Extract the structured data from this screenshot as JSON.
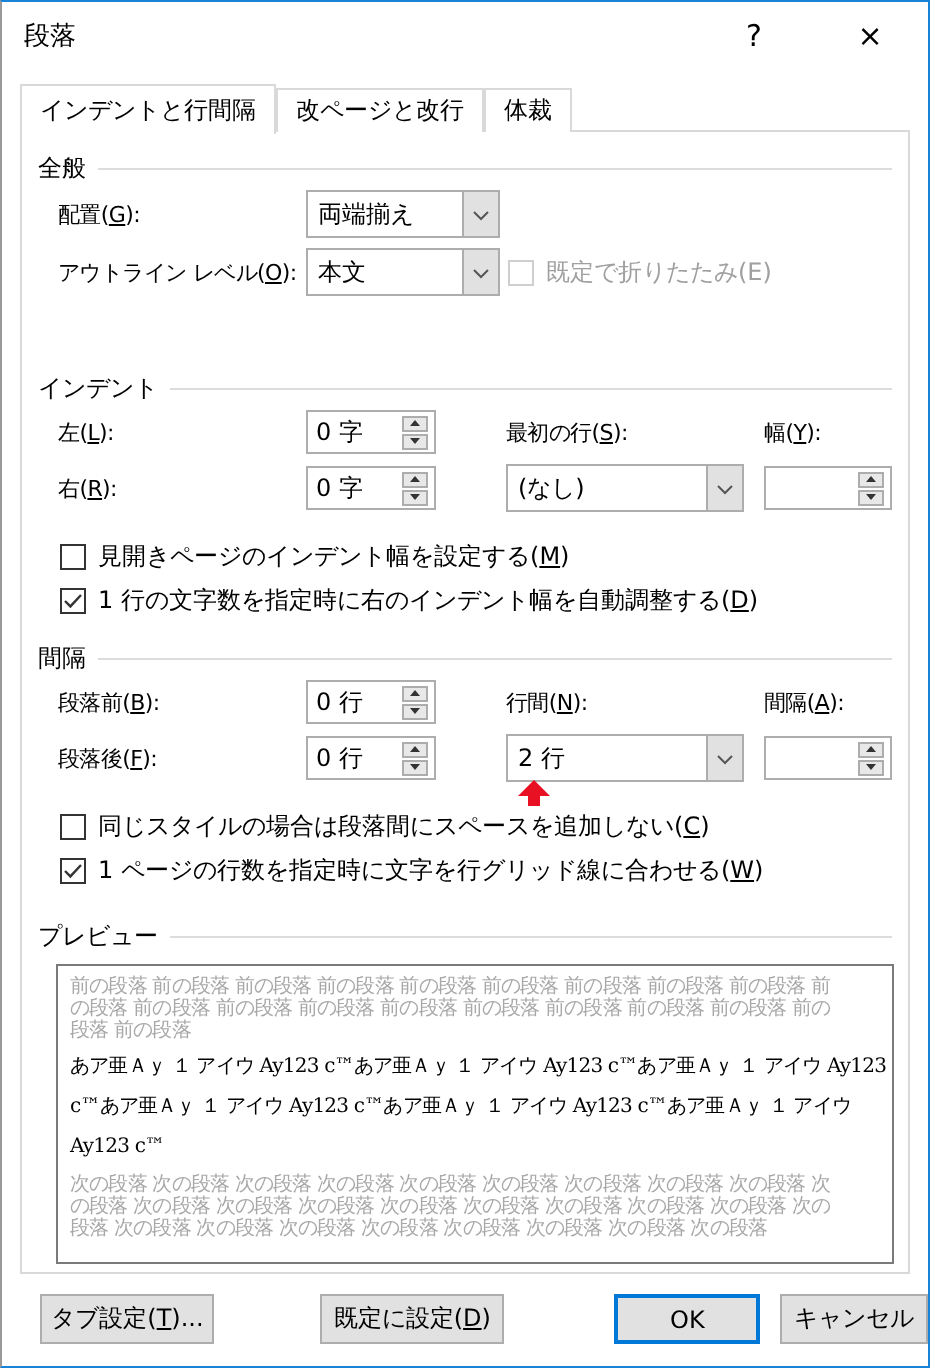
{
  "window": {
    "title": "段落",
    "help": "?",
    "close": "×"
  },
  "tabs": [
    {
      "label": "インデントと行間隔",
      "selected": true
    },
    {
      "label": "改ページと改行",
      "selected": false
    },
    {
      "label": "体裁",
      "selected": false
    }
  ],
  "sections": [
    {
      "title": "全般",
      "rows": [
        {
          "label": [
            "配置(",
            "G",
            "):"
          ],
          "control": {
            "kind": "dropdown",
            "value": "両端揃え"
          }
        },
        {
          "label": [
            "アウトライン レベル(",
            "O",
            "):"
          ],
          "control": {
            "kind": "dropdown",
            "value": "本文"
          },
          "extra": {
            "label": [
              "既定で折りたたみ(E)"
            ],
            "checked": false,
            "disabled": true
          }
        }
      ]
    },
    {
      "title": "インデント",
      "rows": [
        {
          "label": [
            "左(",
            "L",
            "):"
          ],
          "control": {
            "kind": "spin",
            "value": "0 字"
          }
        },
        {
          "label": [
            "右(",
            "R",
            "):"
          ],
          "control": {
            "kind": "spin",
            "value": "0 字"
          }
        }
      ],
      "right": {
        "labels": [
          [
            "最初の行(",
            "S",
            "):"
          ],
          [
            "幅(",
            "Y",
            "):"
          ]
        ],
        "controls": [
          {
            "kind": "dropdown",
            "value": "(なし)"
          },
          {
            "kind": "spin"
          }
        ]
      },
      "checks": [
        {
          "label": [
            "見開きページのインデント幅を設定する(",
            "M",
            ")"
          ],
          "checked": false,
          "disabled": false
        },
        {
          "label": [
            "1 行の文字数を指定時に右のインデント幅を自動調整する(",
            "D",
            ")"
          ],
          "checked": true,
          "disabled": false
        }
      ]
    },
    {
      "title": "間隔",
      "rows": [
        {
          "label": [
            "段落前(",
            "B",
            "):"
          ],
          "control": {
            "kind": "spin",
            "value": "0 行"
          }
        },
        {
          "label": [
            "段落後(",
            "F",
            "):"
          ],
          "control": {
            "kind": "spin",
            "value": "0 行"
          }
        }
      ],
      "right": {
        "labels": [
          [
            "行間(",
            "N",
            "):"
          ],
          [
            "間隔(",
            "A",
            "):"
          ]
        ],
        "controls": [
          {
            "kind": "dropdown",
            "value": "2 行"
          },
          {
            "kind": "spin"
          }
        ]
      },
      "checks": [
        {
          "label": [
            "同じスタイルの場合は段落間にスペースを追加しない(",
            "C",
            ")"
          ],
          "checked": false,
          "disabled": false
        },
        {
          "label": [
            "1 ページの行数を指定時に文字を行グリッド線に合わせる(",
            "W",
            ")"
          ],
          "checked": true,
          "disabled": false
        }
      ]
    }
  ],
  "preview": {
    "title": "プレビュー",
    "paragraphs": [
      {
        "kind": "context",
        "lines": [
          "前の段落 前の段落 前の段落 前の段落 前の段落 前の段落 前の段落 前の段落 前の段落 前",
          "の段落 前の段落 前の段落 前の段落 前の段落 前の段落 前の段落 前の段落 前の段落 前の",
          "段落 前の段落"
        ]
      },
      {
        "kind": "sample",
        "lines": [
          "あア亜Ａｙ １ アイウ Ay123 c™あア亜Ａｙ １ アイウ Ay123 c™あア亜Ａｙ １ アイウ Ay123",
          "c™あア亜Ａｙ １ アイウ Ay123 c™あア亜Ａｙ １ アイウ Ay123 c™あア亜Ａｙ １ アイウ",
          "Ay123 c™"
        ]
      },
      {
        "kind": "context",
        "lines": [
          "次の段落 次の段落 次の段落 次の段落 次の段落 次の段落 次の段落 次の段落 次の段落 次",
          "の段落 次の段落 次の段落 次の段落 次の段落 次の段落 次の段落 次の段落 次の段落 次の",
          "段落 次の段落 次の段落 次の段落 次の段落 次の段落 次の段落 次の段落 次の段落"
        ]
      }
    ]
  },
  "buttons": [
    {
      "label": [
        "タブ設定(",
        "T",
        ")..."
      ],
      "default": false
    },
    {
      "label": [
        "既定に設定(",
        "D",
        ")"
      ],
      "default": false
    },
    {
      "label": [
        "OK"
      ],
      "default": true
    },
    {
      "label": [
        "キャンセル"
      ],
      "default": false
    }
  ],
  "annotations": [
    {
      "kind": "arrow"
    }
  ]
}
